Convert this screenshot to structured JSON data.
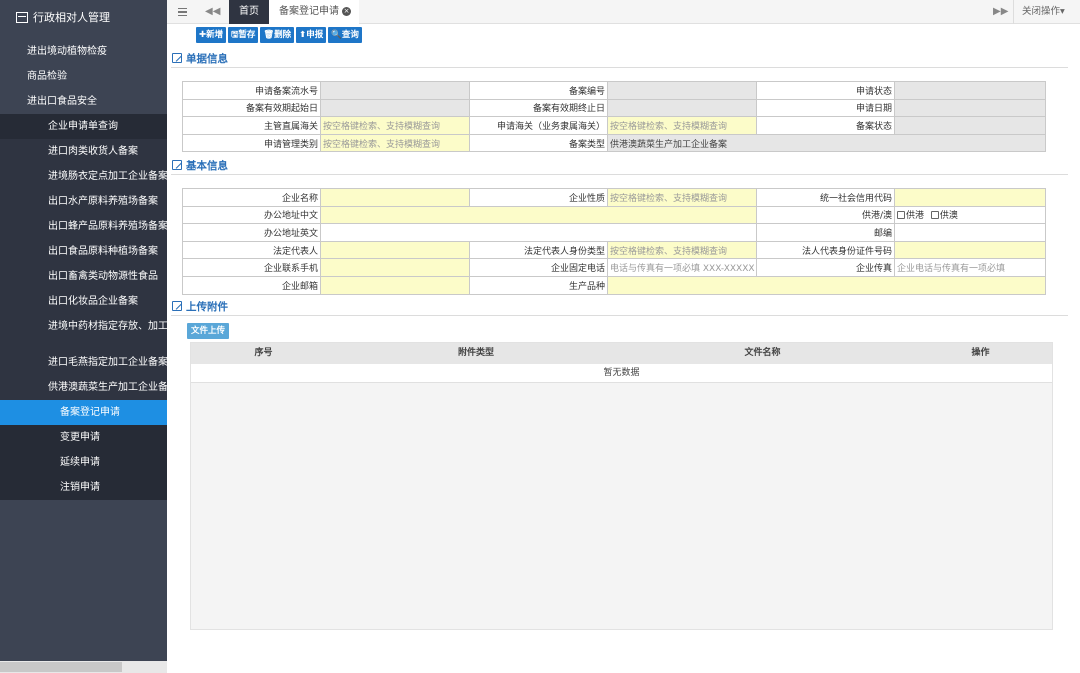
{
  "sidebar": {
    "title": "行政相对人管理",
    "items": [
      "进出境动植物检疫",
      "商品检验",
      "进出口食品安全"
    ],
    "sub_items": [
      "企业申请单查询",
      "进口肉类收货人备案",
      "进境肠衣定点加工企业备案",
      "出口水产原料养殖场备案",
      "出口蜂产品原料养殖场备案",
      "出口食品原料种植场备案",
      "出口畜禽类动物源性食品",
      "出口化妆品企业备案",
      "进境中药材指定存放、加工",
      "进口毛燕指定加工企业备案",
      "供港澳蔬菜生产加工企业备案"
    ],
    "leaf_items": [
      "备案登记申请",
      "变更申请",
      "延续申请",
      "注销申请"
    ]
  },
  "topbar": {
    "menu_icon": "hamburger-icon",
    "prev_label": "◀◀",
    "tab_home": "首页",
    "tab_current": "备案登记申请",
    "tab_close": "×",
    "next_label": "▶▶",
    "close_ops": "关闭操作▾"
  },
  "toolbar": {
    "add": "✚新增",
    "save": "🖫暂存",
    "delete": "🗑删除",
    "declare": "⬆申报",
    "query": "🔍查询"
  },
  "section1": {
    "title": "单据信息",
    "rows": [
      [
        "申请备案流水号",
        "",
        "备案编号",
        "",
        "申请状态",
        ""
      ],
      [
        "备案有效期起始日",
        "",
        "备案有效期终止日",
        "",
        "申请日期",
        ""
      ],
      [
        "主管直属海关",
        "按空格键检索、支持模糊查询",
        "申请海关（业务隶属海关）",
        "按空格键检索、支持模糊查询",
        "备案状态",
        ""
      ],
      [
        "申请管理类别",
        "按空格键检索、支持模糊查询",
        "备案类型",
        "供港澳蔬菜生产加工企业备案"
      ]
    ]
  },
  "section2": {
    "title": "基本信息",
    "company_name": "企业名称",
    "company_nature": "企业性质",
    "company_nature_ph": "按空格键检索、支持模糊查询",
    "credit_code": "统一社会信用代码",
    "office_cn": "办公地址中文",
    "supply_label": "供港/澳",
    "supply_hk": "供港",
    "supply_mo": "供澳",
    "office_en": "办公地址英文",
    "postcode": "邮编",
    "legal_rep": "法定代表人",
    "legal_id_type": "法定代表人身份类型",
    "legal_id_type_ph": "按空格键检索、支持模糊查询",
    "legal_id_no": "法人代表身份证件号码",
    "mobile": "企业联系手机",
    "landline": "企业固定电话",
    "landline_ph": "电话与传真有一项必填  XXX-XXXXX",
    "fax": "企业传真",
    "fax_ph": "企业电话与传真有一项必填",
    "email": "企业邮箱",
    "product": "生产品种"
  },
  "section3": {
    "title": "上传附件",
    "upload_button": "文件上传",
    "columns": [
      "序号",
      "附件类型",
      "文件名称",
      "操作"
    ],
    "empty_text": "暂无数据"
  },
  "colors": {
    "sidebar_bg": "#3d4453",
    "selected": "#1e8fe3",
    "button": "#1e76c8",
    "input_yellow": "#fcfcc9",
    "input_gray": "#e6e6e6"
  }
}
